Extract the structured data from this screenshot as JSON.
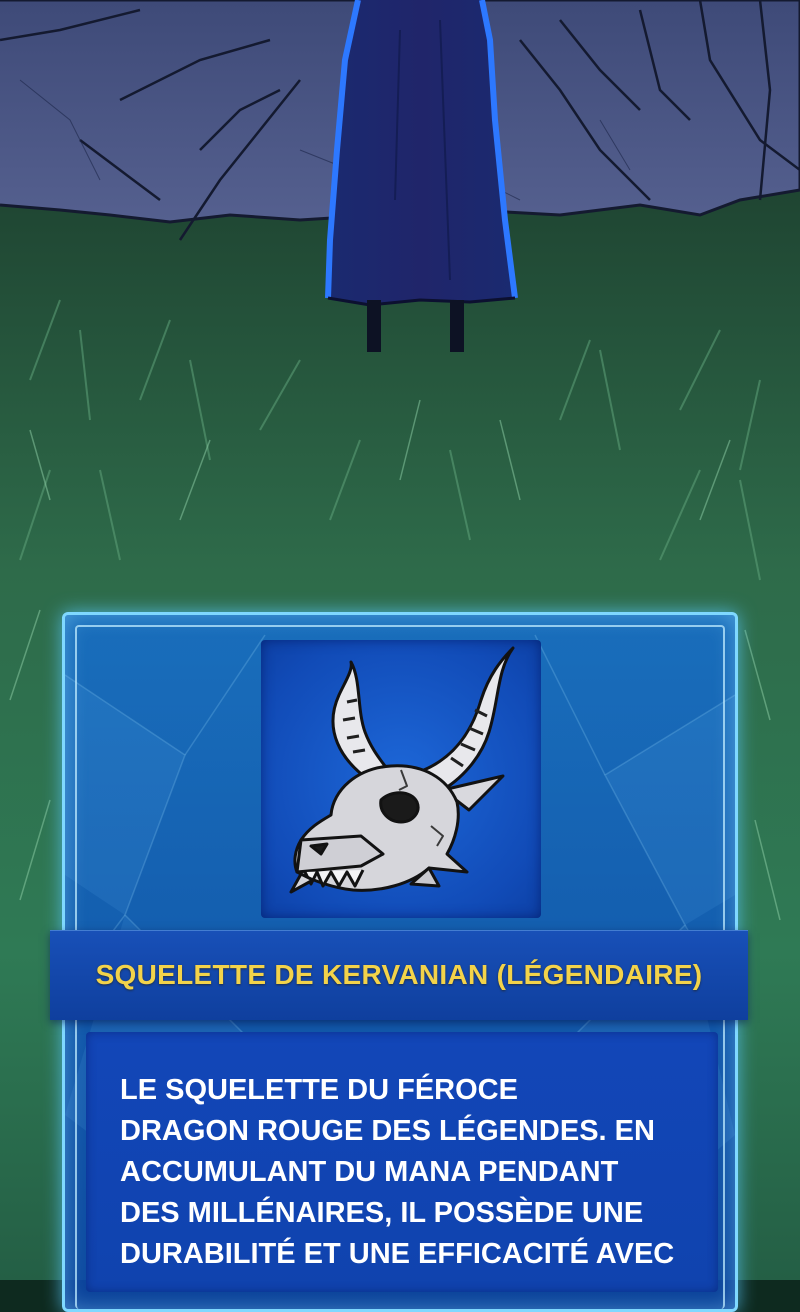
{
  "item_card": {
    "icon": "dragon-skull-icon",
    "title": "SQUELETTE DE KERVANIAN (LÉGENDAIRE)",
    "description_lines": [
      "LE SQUELETTE DU FÉROCE",
      "DRAGON ROUGE DES LÉGENDES. EN",
      "ACCUMULANT DU MANA PENDANT",
      "DES MILLÉNAIRES, IL POSSÈDE UNE",
      "DURABILITÉ ET UNE EFFICACITÉ AVEC"
    ],
    "colors": {
      "frame_glow": "#7fd8ff",
      "panel_blue": "#1246b8",
      "title_gold": "#f3d34a"
    }
  }
}
